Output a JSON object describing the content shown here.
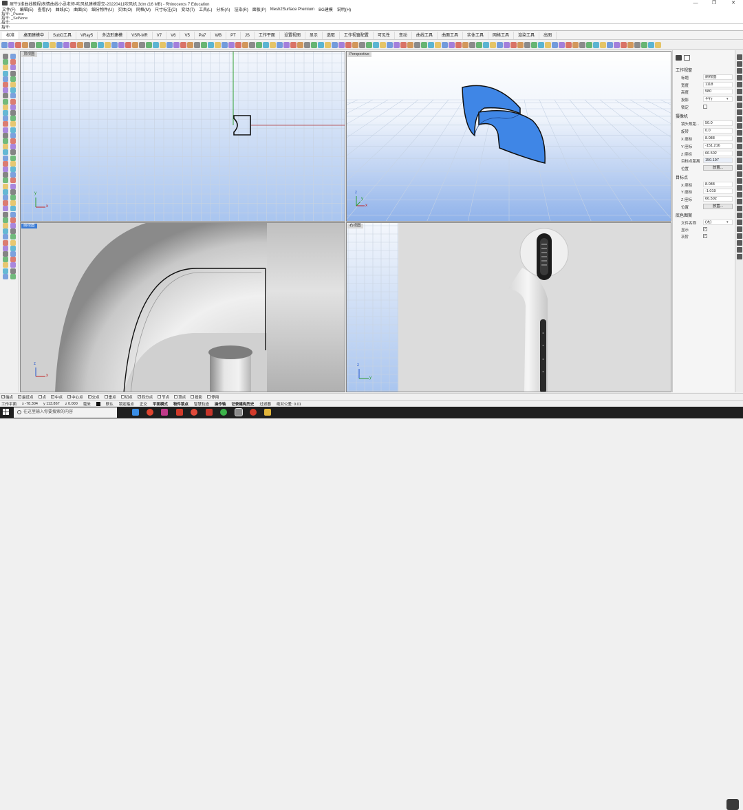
{
  "window": {
    "title": "犀牛3维曲线教程|表情曲线小丞老师-吹风机建模提交-20220411吹风机.3dm (16 MB) - Rhinoceros 7 Education",
    "controls": [
      "—",
      "❐",
      "✕"
    ]
  },
  "menu": [
    "文件(F)",
    "编辑(E)",
    "查看(V)",
    "曲线(C)",
    "曲面(S)",
    "细分物件(U)",
    "实体(O)",
    "网格(M)",
    "尺寸标注(D)",
    "变动(T)",
    "工具(L)",
    "分析(A)",
    "渲染(R)",
    "面板(P)",
    "Mesh2Surface Premium",
    "BG建模",
    "说明(H)"
  ],
  "command_history": [
    "指令: _Pause",
    "指令: _SelNone",
    "指令:"
  ],
  "command_prompt": "指令:",
  "tabs": [
    "标准",
    "桌面建模中",
    "SubD工具",
    "VRay5",
    "多边形建模",
    "VSR-MR",
    "V7",
    "V6",
    "V5",
    "Pa7",
    "WB",
    "PT",
    "JS",
    "工作平面",
    "设置视图",
    "显示",
    "选取",
    "工作视窗配置",
    "可见性",
    "变动",
    "曲线工具",
    "曲面工具",
    "实体工具",
    "网格工具",
    "渲染工具",
    "出图"
  ],
  "active_tab": "标准",
  "viewports": {
    "top": {
      "label": "顶视图",
      "axis_x": "x",
      "axis_y": "y"
    },
    "perspective": {
      "label": "Perspective",
      "axis_x": "x",
      "axis_y": "y",
      "axis_z": "z"
    },
    "front": {
      "label": "前视图",
      "axis_x": "x",
      "axis_z": "z"
    },
    "right": {
      "label": "右视图",
      "axis_y": "y",
      "axis_z": "z"
    }
  },
  "properties": {
    "section_viewport": "工作视窗",
    "title_label": "标题",
    "title_value": "前视图",
    "width_label": "宽度",
    "width_value": "1118",
    "height_label": "高度",
    "height_value": "580",
    "projection_label": "投影",
    "projection_value": "平行",
    "locked_label": "锁定",
    "section_camera": "摄像机",
    "lens_label": "镜头焦距...",
    "lens_value": "50.0",
    "rotation_label": "旋转",
    "rotation_value": "0.0",
    "cam_x_label": "X 座标",
    "cam_x_value": "8.088",
    "cam_y_label": "Y 座标",
    "cam_y_value": "-151.216",
    "cam_z_label": "Z 座标",
    "cam_z_value": "66.502",
    "target_dist_label": "目标点距离",
    "target_dist_value": "150.197",
    "position_label": "位置",
    "position_button": "放置...",
    "section_target": "目标点",
    "tgt_x_label": "X 座标",
    "tgt_x_value": "8.088",
    "tgt_y_label": "Y 座标",
    "tgt_y_value": "-1.019",
    "tgt_z_label": "Z 座标",
    "tgt_z_value": "66.502",
    "tgt_position_label": "位置",
    "tgt_position_button": "放置...",
    "section_wallpaper": "底色图案",
    "filename_label": "文件名称",
    "filename_value": "(无)",
    "show_label": "显示",
    "gray_label": "灰阶"
  },
  "osnaps": [
    {
      "label": "端点",
      "checked": true
    },
    {
      "label": "最近点",
      "checked": true
    },
    {
      "label": "点",
      "checked": false
    },
    {
      "label": "中点",
      "checked": true
    },
    {
      "label": "中心点",
      "checked": true
    },
    {
      "label": "交点",
      "checked": true
    },
    {
      "label": "垂点",
      "checked": false
    },
    {
      "label": "切点",
      "checked": false
    },
    {
      "label": "四分点",
      "checked": true
    },
    {
      "label": "节点",
      "checked": false
    },
    {
      "label": "顶点",
      "checked": false
    },
    {
      "label": "投影",
      "checked": false
    },
    {
      "label": "停用",
      "checked": false
    }
  ],
  "status": {
    "cplane": "工作平面",
    "x": "x -78.304",
    "y": "y 113.867",
    "z": "z 0.000",
    "unit": "毫米",
    "layer": "默认",
    "items": [
      "锁定格点",
      "正交",
      "平面模式",
      "物件锁点",
      "智慧轨迹",
      "操作轴",
      "记录建构历史",
      "过滤器",
      "绝对公差: 0.01"
    ]
  },
  "taskbar": {
    "search_placeholder": "在这里输入你要搜索的内容"
  },
  "colors": {
    "accent": "#3a7bd5",
    "surface_blue": "#3f86e6",
    "grid_bg_top": "#eef3fb",
    "grid_bg_bottom": "#8fb2ea"
  }
}
